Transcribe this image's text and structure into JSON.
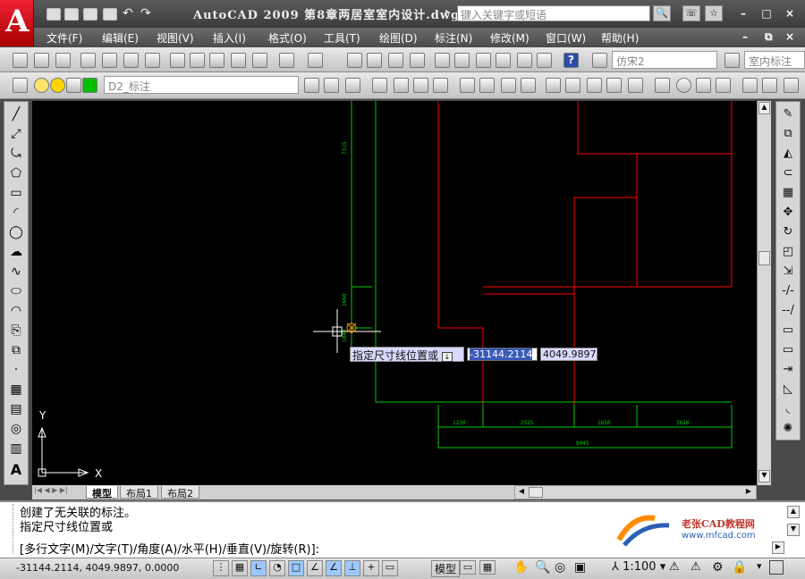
{
  "app": {
    "logo_letter": "A",
    "title": "AutoCAD 2009  第8章两居室室内设计.dwg",
    "search_placeholder": "键入关键字或短语"
  },
  "window_controls": [
    "–",
    "□",
    "×"
  ],
  "doc_controls": [
    "–",
    "⧉",
    "×"
  ],
  "menu": [
    "文件(F)",
    "编辑(E)",
    "视图(V)",
    "插入(I)",
    "格式(O)",
    "工具(T)",
    "绘图(D)",
    "标注(N)",
    "修改(M)",
    "窗口(W)",
    "帮助(H)"
  ],
  "toolbar": {
    "text_style": "仿宋2",
    "dim_style": "室内标注",
    "layer": "D2_标注"
  },
  "drawing": {
    "dim_vertical_1": "7315",
    "dim_vertical_2": "1660",
    "dim_vertical_3": "1040",
    "dim_bottom": [
      "1230",
      "2525",
      "1650",
      "2610"
    ],
    "dim_total": "8045",
    "ucs_x": "X",
    "ucs_y": "Y"
  },
  "dynamic_input": {
    "prompt": "指定尺寸线位置或",
    "x_value": "-31144.2114",
    "y_value": "4049.9897"
  },
  "tabs": [
    "模型",
    "布局1",
    "布局2"
  ],
  "command": {
    "line1": "创建了无关联的标注。",
    "line2": "指定尺寸线位置或",
    "line3": "[多行文字(M)/文字(T)/角度(A)/水平(H)/垂直(V)/旋转(R)]:"
  },
  "watermark": {
    "brand": "老张CAD教程网",
    "url": "www.mfcad.com"
  },
  "status": {
    "coords": "-31144.2114,  4049.9897,  0.0000",
    "model_label": "模型",
    "scale": "1:100"
  },
  "colors": {
    "canvas": "#000000",
    "wall": "#ff0000",
    "dimension": "#00ff00",
    "ucs": "#ffffff"
  }
}
